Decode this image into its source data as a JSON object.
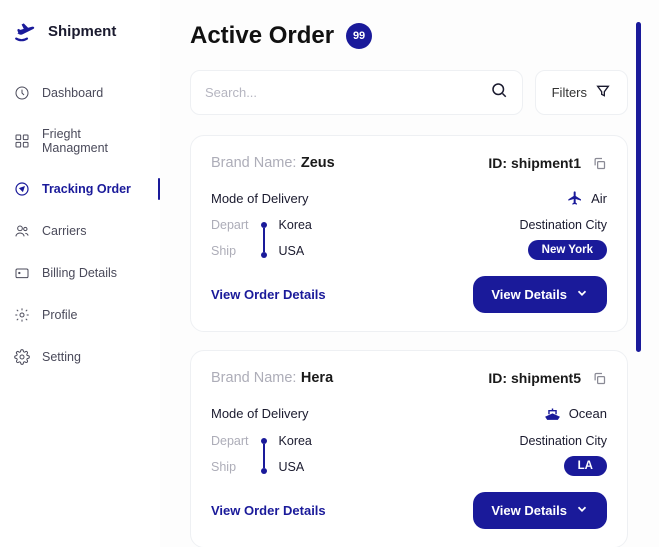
{
  "logo": {
    "text": "Shipment"
  },
  "nav": {
    "items": [
      {
        "label": "Dashboard"
      },
      {
        "label": "Frieght Managment"
      },
      {
        "label": "Tracking Order"
      },
      {
        "label": "Carriers"
      },
      {
        "label": "Billing Details"
      },
      {
        "label": "Profile"
      },
      {
        "label": "Setting"
      }
    ]
  },
  "header": {
    "title": "Active Order",
    "badge": "99"
  },
  "search": {
    "placeholder": "Search..."
  },
  "filters": {
    "label": "Filters"
  },
  "labels": {
    "brand": "Brand Name:",
    "id": "ID:",
    "mode": "Mode of Delivery",
    "depart": "Depart",
    "ship": "Ship",
    "dest": "Destination City",
    "view_order_details": "View Order Details",
    "view_details": "View Details"
  },
  "orders": [
    {
      "brand": "Zeus",
      "id": "shipment1",
      "mode": "Air",
      "depart": "Korea",
      "ship": "USA",
      "dest": "New York"
    },
    {
      "brand": "Hera",
      "id": "shipment5",
      "mode": "Ocean",
      "depart": "Korea",
      "ship": "USA",
      "dest": "LA"
    }
  ]
}
